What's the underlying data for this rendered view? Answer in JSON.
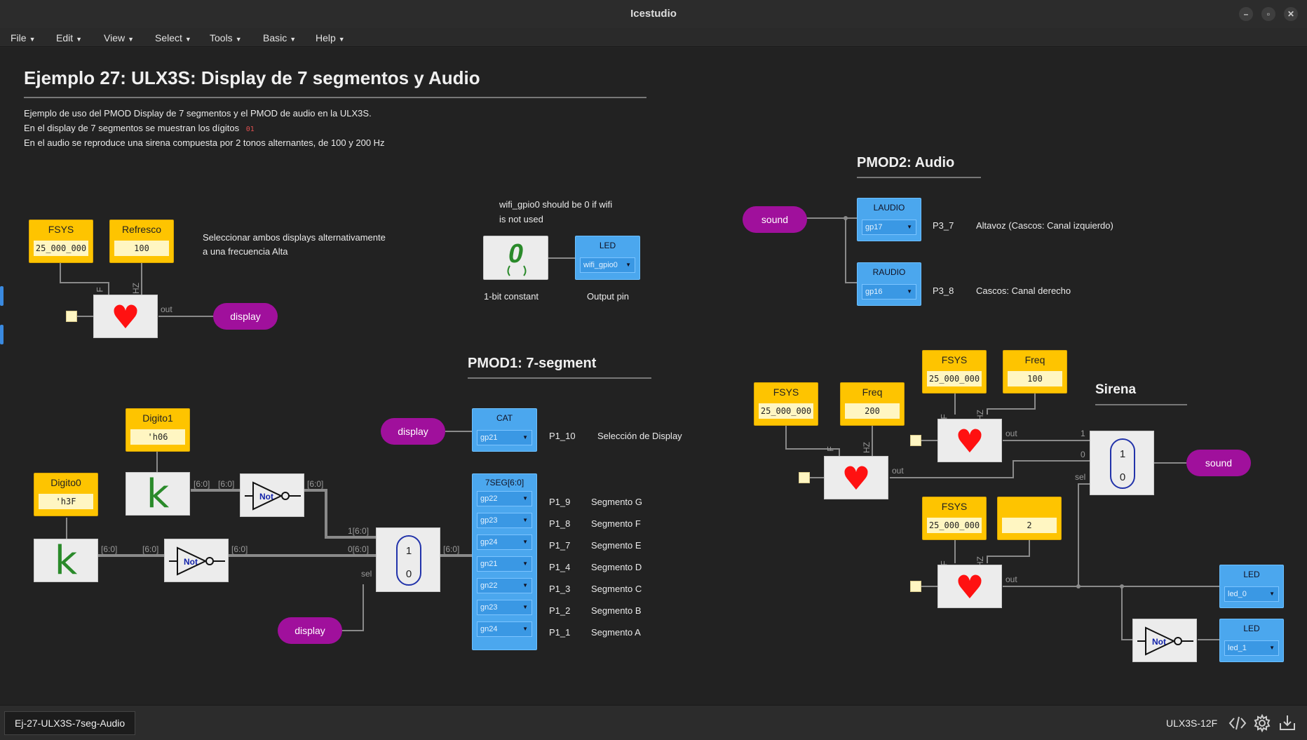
{
  "window": {
    "title": "Icestudio"
  },
  "menu": {
    "items": [
      "File",
      "Edit",
      "View",
      "Select",
      "Tools",
      "Basic",
      "Help"
    ]
  },
  "header": {
    "title": "Ejemplo 27: ULX3S: Display de 7 segmentos y Audio",
    "lines": [
      "Ejemplo de uso del PMOD Display de 7 segmentos y el PMOD de audio en la ULX3S.",
      "En el display de 7 segmentos se muestran los dígitos",
      "En el audio se reproduce una sirena compuesta por 2 tonos alternantes, de 100 y 200 Hz"
    ],
    "digits_code": "01"
  },
  "left": {
    "fsys": {
      "label": "FSYS",
      "value": "25_000_000"
    },
    "refresco": {
      "label": "Refresco",
      "value": "100"
    },
    "note1": "Seleccionar ambos displays alternativamente",
    "note2": "a una frecuencia Alta",
    "out_label": "out",
    "display_label": "display",
    "digito1": {
      "label": "Digito1",
      "value": "'h06"
    },
    "digito0": {
      "label": "Digito0",
      "value": "'h3F"
    },
    "not_label": "Not",
    "w60": "[6:0]",
    "in1": "1[6:0]",
    "in0": "0[6:0]",
    "sel": "sel",
    "f": "F",
    "hz": "HZ",
    "k": "k"
  },
  "middle": {
    "wifi_note1": "wifi_gpio0 should be 0 if wifi",
    "wifi_note2": "is not used",
    "const_val": "0",
    "const_label": "1-bit constant",
    "led": {
      "label": "LED",
      "pin": "wifi_gpio0"
    },
    "output_label": "Output pin",
    "pmod1_title": "PMOD1: 7-segment",
    "display_label": "display",
    "cat": {
      "label": "CAT",
      "pin": "gp21",
      "port": "P1_10",
      "desc": "Selección de Display"
    },
    "seg_label": "7SEG[6:0]",
    "segs": [
      {
        "pin": "gp22",
        "port": "P1_9",
        "desc": "Segmento G"
      },
      {
        "pin": "gp23",
        "port": "P1_8",
        "desc": "Segmento F"
      },
      {
        "pin": "gp24",
        "port": "P1_7",
        "desc": "Segmento E"
      },
      {
        "pin": "gn21",
        "port": "P1_4",
        "desc": "Segmento D"
      },
      {
        "pin": "gn22",
        "port": "P1_3",
        "desc": "Segmento C"
      },
      {
        "pin": "gn23",
        "port": "P1_2",
        "desc": "Segmento B"
      },
      {
        "pin": "gn24",
        "port": "P1_1",
        "desc": "Segmento A"
      }
    ]
  },
  "right": {
    "pmod2_title": "PMOD2: Audio",
    "sound_label": "sound",
    "laudio": {
      "label": "LAUDIO",
      "pin": "gp17",
      "port": "P3_7",
      "desc": "Altavoz (Cascos: Canal izquierdo)"
    },
    "raudio": {
      "label": "RAUDIO",
      "pin": "gp16",
      "port": "P3_8",
      "desc": "Cascos: Canal derecho"
    },
    "sirena_title": "Sirena",
    "fsys_a": {
      "label": "FSYS",
      "value": "25_000_000"
    },
    "freq_a": {
      "label": "Freq",
      "value": "100"
    },
    "fsys_b": {
      "label": "FSYS",
      "value": "25_000_000"
    },
    "freq_b": {
      "label": "Freq",
      "value": "200"
    },
    "fsys_c": {
      "label": "FSYS",
      "value": "25_000_000"
    },
    "freq_c": {
      "label": "",
      "value": "2"
    },
    "in1": "1",
    "in0": "0",
    "sel": "sel",
    "out": "out",
    "led0": {
      "label": "LED",
      "pin": "led_0"
    },
    "led1": {
      "label": "LED",
      "pin": "led_1"
    },
    "not_label": "Not"
  },
  "status": {
    "tab": "Ej-27-ULX3S-7seg-Audio",
    "board": "ULX3S-12F"
  },
  "colors": {
    "param": "#fec400",
    "io": "#4ba7ee",
    "pill": "#a0109c",
    "heart": "#ff1111"
  }
}
